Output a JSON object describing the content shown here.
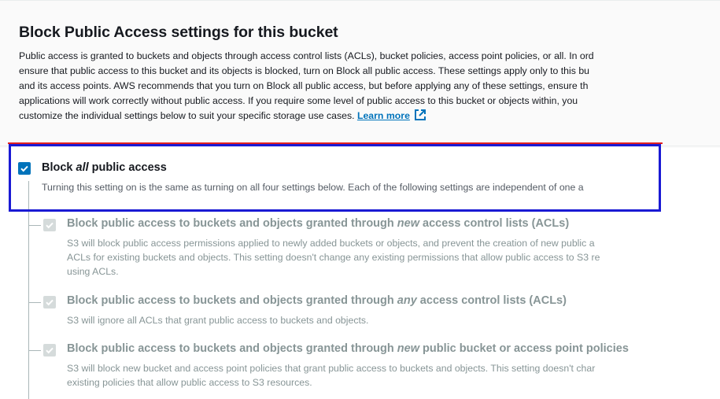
{
  "section": {
    "title": "Block Public Access settings for this bucket",
    "description_lines": [
      "Public access is granted to buckets and objects through access control lists (ACLs), bucket policies, access point policies, or all. In ord",
      "ensure that public access to this bucket and its objects is blocked, turn on Block all public access. These settings apply only to this bu",
      "and its access points. AWS recommends that you turn on Block all public access, but before applying any of these settings, ensure th",
      "applications will work correctly without public access. If you require some level of public access to this bucket or objects within, you",
      "customize the individual settings below to suit your specific storage use cases."
    ],
    "learn_more": "Learn more",
    "learn_more_icon": "external-link-icon"
  },
  "master_setting": {
    "label_before": "Block ",
    "label_emphasis": "all",
    "label_after": " public access",
    "checked": true,
    "description": "Turning this setting on is the same as turning on all four settings below. Each of the following settings are independent of one a"
  },
  "sub_settings": [
    {
      "label_before": "Block public access to buckets and objects granted through ",
      "label_emphasis": "new",
      "label_after": " access control lists (ACLs)",
      "checked": true,
      "disabled": true,
      "description_lines": [
        "S3 will block public access permissions applied to newly added buckets or objects, and prevent the creation of new public a",
        "ACLs for existing buckets and objects. This setting doesn't change any existing permissions that allow public access to S3 re",
        "using ACLs."
      ]
    },
    {
      "label_before": "Block public access to buckets and objects granted through ",
      "label_emphasis": "any",
      "label_after": " access control lists (ACLs)",
      "checked": true,
      "disabled": true,
      "description_lines": [
        "S3 will ignore all ACLs that grant public access to buckets and objects."
      ]
    },
    {
      "label_before": "Block public access to buckets and objects granted through ",
      "label_emphasis": "new",
      "label_after": " public bucket or access point policies",
      "checked": true,
      "disabled": true,
      "description_lines": [
        "S3 will block new bucket and access point policies that grant public access to buckets and objects. This setting doesn't char",
        "existing policies that allow public access to S3 resources."
      ]
    }
  ],
  "colors": {
    "accent": "#0073bb",
    "highlight_border": "#1a1ad4",
    "highlight_top": "#e02020",
    "disabled_text": "#879596"
  }
}
